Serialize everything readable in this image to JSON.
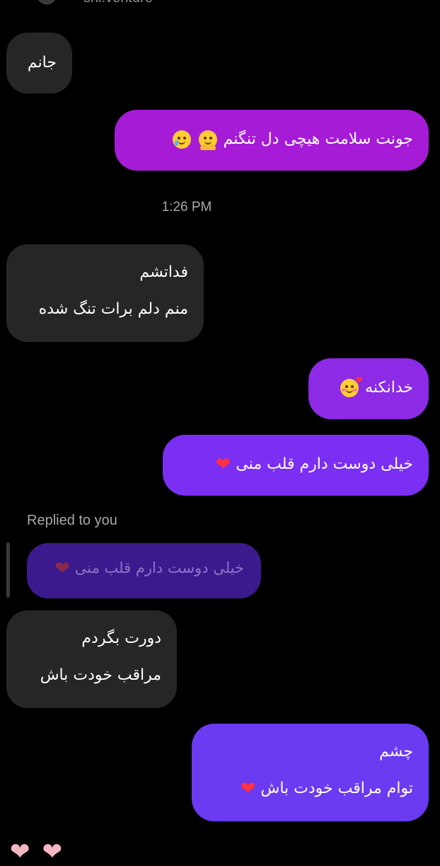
{
  "header": {
    "username": "shi.venture"
  },
  "timestamp": "1:26 PM",
  "replied_label": "Replied to you",
  "messages": {
    "m1": {
      "text": "جانم"
    },
    "m2": {
      "text": "جونت سلامت هیچی دل تنگنم",
      "emoji_1": "smiling-face-with-tear-emoji",
      "emoji_2": "hugging-face-emoji"
    },
    "m3": {
      "line1": "فداتشم",
      "line2": "منم دلم برات تنگ شده"
    },
    "m4": {
      "text": "خدانکنه",
      "emoji": "smiling-face-with-hearts-emoji"
    },
    "m5": {
      "text": "خیلی دوست دارم قلب منی",
      "emoji": "red-heart-emoji"
    },
    "quoted": {
      "text": "خیلی دوست دارم قلب منی",
      "emoji": "red-heart-emoji"
    },
    "m6": {
      "line1": "دورت بگردم",
      "line2": "مراقب خودت باش"
    },
    "m7": {
      "line1": "چشم",
      "line2": "توام مراقب خودت باش",
      "emoji": "red-heart-emoji"
    }
  },
  "reactions": [
    "heart-emoji",
    "heart-emoji"
  ],
  "colors": {
    "incoming_bubble": "#262626",
    "outgoing_magenta": "#a51bd6",
    "outgoing_violet": "#7a2ff2",
    "outgoing_indigo": "#6a3bf0",
    "quoted_bubble": "#3b1a8e",
    "timestamp_text": "#a8a8a8"
  }
}
